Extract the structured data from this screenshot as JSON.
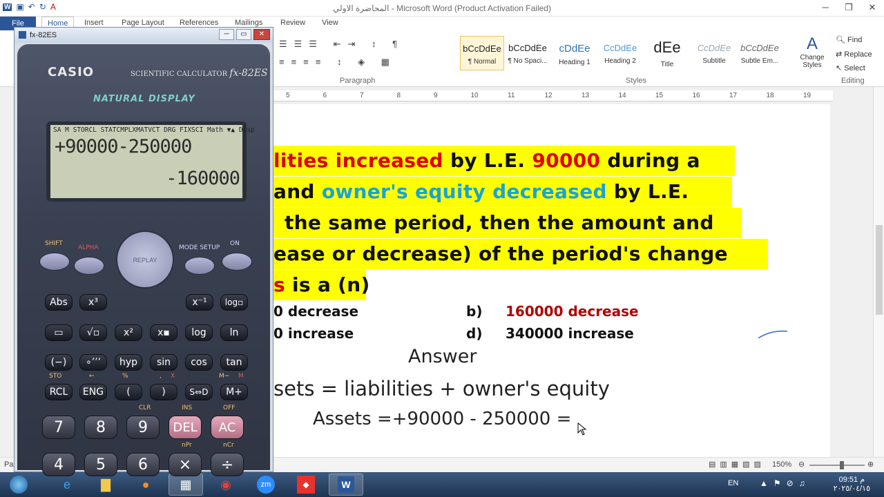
{
  "word": {
    "title": "المحاضرة الاولي  -  Microsoft Word (Product Activation Failed)",
    "tabs": {
      "file": "File",
      "home": "Home",
      "insert": "Insert",
      "page_layout": "Page Layout",
      "references": "References",
      "mailings": "Mailings",
      "review": "Review",
      "view": "View"
    },
    "groups": {
      "paragraph": "Paragraph",
      "styles": "Styles",
      "editing": "Editing"
    },
    "styles": [
      {
        "sample": "bCcDdEe",
        "name": "¶ Normal"
      },
      {
        "sample": "bCcDdEe",
        "name": "¶ No Spaci..."
      },
      {
        "sample": "cDdEe",
        "name": "Heading 1"
      },
      {
        "sample": "CcDdEe",
        "name": "Heading 2"
      },
      {
        "sample": "dEe",
        "name": "Title"
      },
      {
        "sample": "CcDdEe",
        "name": "Subtitle"
      },
      {
        "sample": "bCcDdEe",
        "name": "Subtle Em..."
      }
    ],
    "change_styles": "Change Styles",
    "editing": {
      "find": "Find",
      "replace": "Replace",
      "select": "Select"
    },
    "ruler_nums": [
      "5",
      "6",
      "7",
      "8",
      "9",
      "10",
      "11",
      "12",
      "13",
      "14",
      "15",
      "16",
      "17",
      "18",
      "19"
    ],
    "zoom": "150%",
    "status_left": "Pa"
  },
  "doc": {
    "line1": {
      "a": "lities increased",
      "b": " by L.E. ",
      "c": "90000",
      "d": " during a"
    },
    "line2": {
      "a": " and ",
      "b": "owner's equity decreased",
      "c": " by L.E."
    },
    "line3": "the same period, then the amount and",
    "line4": "ease or decrease) of the period's change",
    "line5": "is a (n)",
    "opts": {
      "a": "0 decrease",
      "b_label": "b)",
      "b": "160000 decrease",
      "c": "0 increase",
      "d_label": "d)",
      "d": "340000 increase"
    },
    "answer": "Answer",
    "equation": "sets = liabilities + owner's equity",
    "assets_line": "Assets =+90000   - 250000 ="
  },
  "calc": {
    "window_title": "fx-82ES",
    "brand": "CASIO",
    "model_prefix": "SCIENTIFIC CALCULATOR",
    "model": "fx-82ES",
    "natural": "NATURAL DISPLAY",
    "indicators": "SA M STORCL STATCMPLXMATVCT DRG FIXSCI Math ▼▲ Disp",
    "expression": "+90000-250000",
    "result": "-160000",
    "top": {
      "shift": "SHIFT",
      "alpha": "ALPHA",
      "mode": "MODE SETUP",
      "on": "ON",
      "replay": "REPLAY"
    },
    "row1": [
      "Abs",
      "x³",
      "x⁻¹",
      "log▫"
    ],
    "row2": [
      "▭",
      "√▫",
      "x²",
      "x▪",
      "log",
      "ln"
    ],
    "row3": [
      "(−)",
      "∘’’’",
      "hyp",
      "sin",
      "cos",
      "tan"
    ],
    "row4": [
      "RCL",
      "ENG",
      "(",
      ")",
      "S⇔D",
      "M+"
    ],
    "row5": [
      "7",
      "8",
      "9",
      "DEL",
      "AC"
    ],
    "row6": [
      "4",
      "5",
      "6",
      "×",
      "÷"
    ],
    "shift_labels": {
      "row4": [
        "STO",
        "←",
        "%",
        ",",
        "X",
        "M−",
        "M"
      ],
      "row5": [
        "CLR",
        "INS",
        "OFF"
      ],
      "row6": [
        "nPr",
        "nCr"
      ]
    }
  },
  "taskbar": {
    "lang": "EN",
    "time": "09:51 م",
    "date": "٢٠٢٥/٠٤/١٥"
  }
}
